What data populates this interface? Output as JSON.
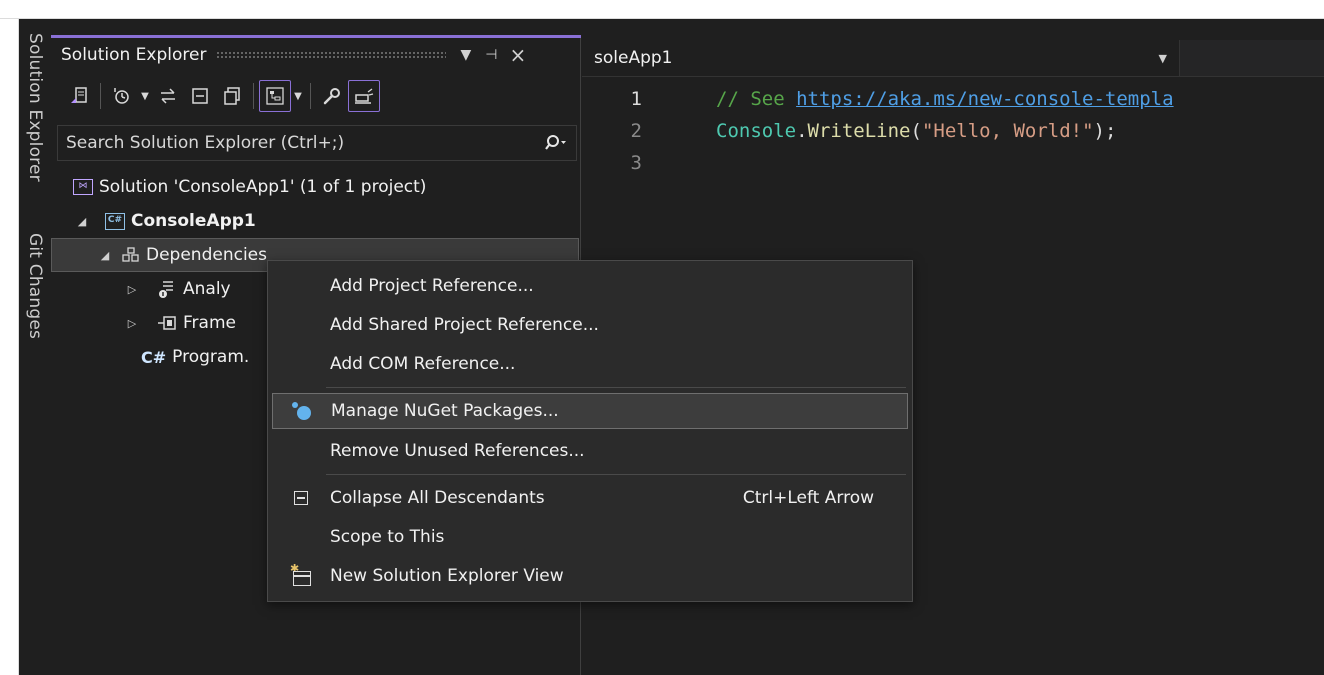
{
  "side_tabs": [
    "Solution Explorer",
    "Git Changes"
  ],
  "solution_explorer": {
    "title": "Solution Explorer",
    "header_buttons": {
      "dropdown": "▼",
      "pin": "⊣",
      "close": "×"
    },
    "search_placeholder": "Search Solution Explorer (Ctrl+;)",
    "tree": {
      "solution": "Solution 'ConsoleApp1' (1 of 1 project)",
      "project": "ConsoleApp1",
      "dependencies": "Dependencies",
      "analyzers": "Analy",
      "frameworks": "Frame",
      "program": "Program.",
      "cs_badge": "C#"
    }
  },
  "editor": {
    "nav_label": "soleApp1",
    "lines": [
      {
        "number": "1",
        "comment": "// See ",
        "link": "https://aka.ms/new-console-templa"
      },
      {
        "number": "2",
        "type": "Console",
        "dot": ".",
        "method": "WriteLine",
        "open": "(",
        "string": "\"Hello, World!\"",
        "close": ");"
      },
      {
        "number": "3"
      }
    ]
  },
  "context_menu": {
    "items": [
      {
        "label": "Add Project Reference..."
      },
      {
        "label": "Add Shared Project Reference..."
      },
      {
        "label": "Add COM Reference..."
      },
      {
        "label": "Manage NuGet Packages...",
        "icon": "nuget-icon"
      },
      {
        "label": "Remove Unused References..."
      },
      {
        "label": "Collapse All Descendants",
        "shortcut": "Ctrl+Left Arrow",
        "icon": "collapse-icon"
      },
      {
        "label": "Scope to This"
      },
      {
        "label": "New Solution Explorer View",
        "icon": "new-view-icon"
      }
    ]
  },
  "colors": {
    "accent": "#8a70d6",
    "background": "#1f1f1f",
    "menu_background": "#2b2b2b",
    "comment": "#57a64a",
    "link": "#4f9fe6",
    "type": "#4ec9b0",
    "method": "#dcdcaa",
    "string": "#d69d85"
  }
}
